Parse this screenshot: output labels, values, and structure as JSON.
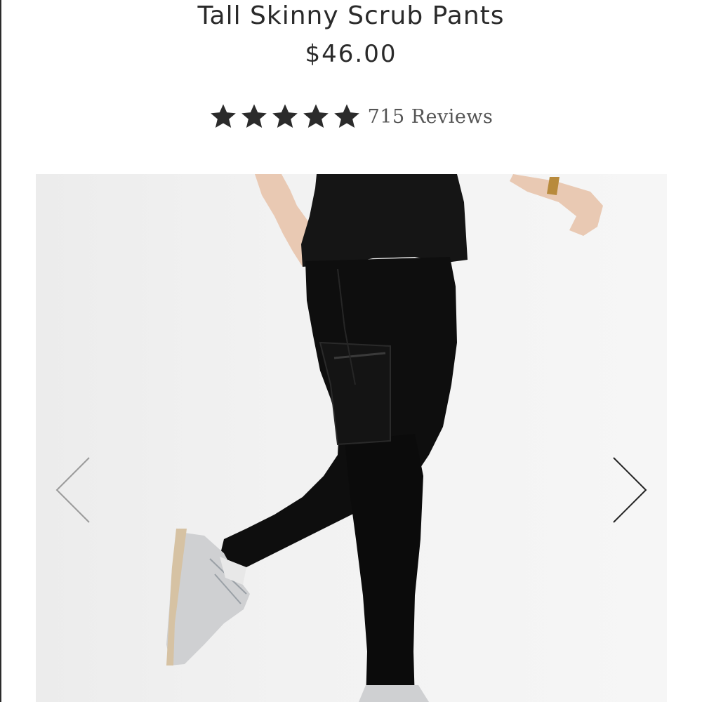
{
  "product": {
    "title": "Tall Skinny Scrub Pants",
    "price": "$46.00"
  },
  "rating": {
    "stars": 5,
    "max_stars": 5,
    "reviews_text": "715 Reviews",
    "star_color": "#2b2b2b"
  },
  "gallery": {
    "prev_icon": "chevron-left-icon",
    "next_icon": "chevron-right-icon",
    "prev_color": "#9a9a9a",
    "next_color": "#222222"
  }
}
